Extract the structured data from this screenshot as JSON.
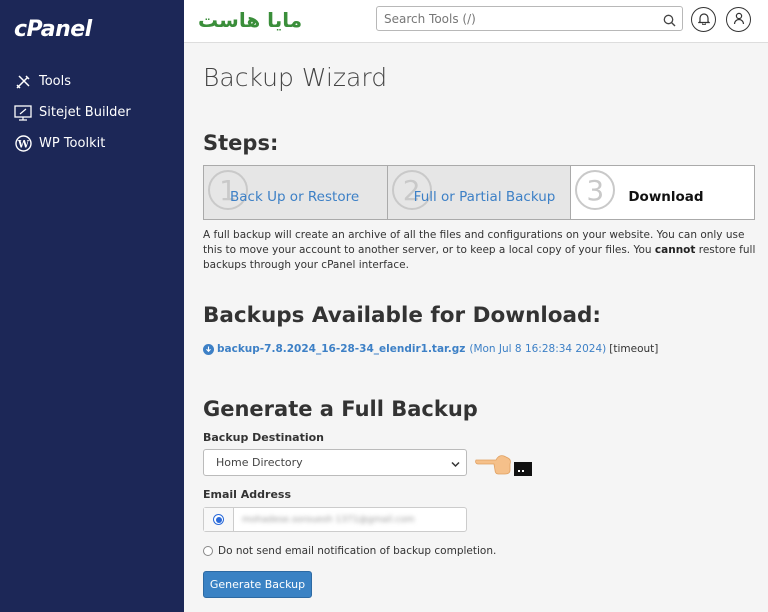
{
  "sidebar": {
    "logo": "cPanel",
    "items": [
      {
        "label": "Tools",
        "icon": "tools-icon"
      },
      {
        "label": "Sitejet Builder",
        "icon": "sitejet-icon"
      },
      {
        "label": "WP Toolkit",
        "icon": "wordpress-icon"
      }
    ]
  },
  "topbar": {
    "brand": "مايا هاست",
    "search_placeholder": "Search Tools (/)"
  },
  "page": {
    "title": "Backup Wizard",
    "steps_title": "Steps:",
    "steps": [
      {
        "num": "1",
        "label": "Back Up or Restore"
      },
      {
        "num": "2",
        "label": "Full or Partial Backup"
      },
      {
        "num": "3",
        "label": "Download"
      }
    ],
    "description_1": "A full backup will create an archive of all the files and configurations on your website. You can only use this to move your account to another server, or to keep a local copy of your files. You ",
    "description_bold": "cannot",
    "description_2": " restore full backups through your cPanel interface.",
    "available_title": "Backups Available for Download:",
    "backup": {
      "filename": "backup-7.8.2024_16-28-34_elendir1.tar.gz",
      "date": "(Mon Jul 8 16:28:34 2024)",
      "status": "[timeout]"
    },
    "generate_title": "Generate a Full Backup",
    "destination_label": "Backup Destination",
    "destination_value": "Home Directory",
    "email_label": "Email Address",
    "email_value": "mohadese.sorouesh 1371@gmail.com",
    "no_email_label": "Do not send email notification of backup completion.",
    "generate_button": "Generate Backup"
  },
  "colors": {
    "sidebar_bg": "#1c2757",
    "link_blue": "#3d80c6",
    "button_blue": "#3a82c4",
    "brand_green": "#3a8e3a"
  }
}
